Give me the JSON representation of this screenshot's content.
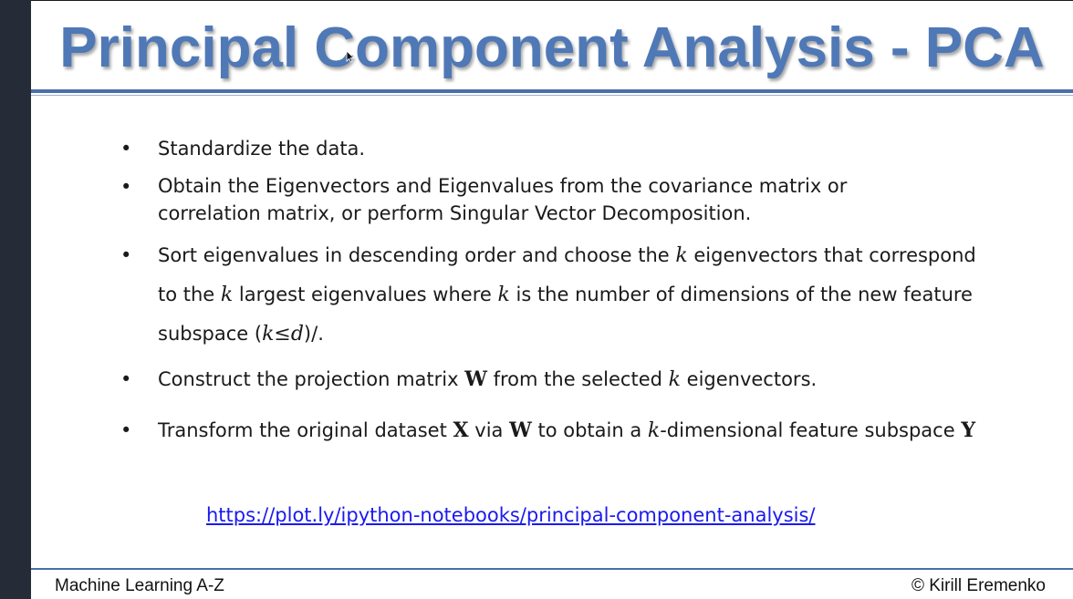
{
  "slide": {
    "title": "Principal Component Analysis - PCA",
    "bullet_glyph": "•",
    "bullets": {
      "b1": {
        "text": "Standardize the data."
      },
      "b2": {
        "line1": "Obtain the Eigenvectors and Eigenvalues from the covariance matrix or",
        "line2": "correlation matrix, or perform Singular Vector Decomposition."
      },
      "b3": {
        "t1": "Sort eigenvalues in descending order and choose the ",
        "k1": "k",
        "t2": " eigenvectors that correspond to the ",
        "k2": "k",
        "t3": " largest eigenvalues where ",
        "k3": "k",
        "t4": " is the number of dimensions of the new feature subspace (",
        "expr": "k≤d",
        "t5": ")/."
      },
      "b4": {
        "t1": "Construct the projection matrix ",
        "W": "W",
        "t2": " from the selected ",
        "k": "k",
        "t3": " eigenvectors."
      },
      "b5": {
        "t1": "Transform the original dataset ",
        "X": "X",
        "t2": " via ",
        "W": "W",
        "t3": " to obtain a ",
        "k": "k",
        "t4": "-dimensional feature subspace ",
        "Y": "Y"
      }
    },
    "link": "https://plot.ly/ipython-notebooks/principal-component-analysis/"
  },
  "footer": {
    "left": "Machine Learning A-Z",
    "right": "© Kirill Eremenko"
  },
  "colors": {
    "title": "#4f78b6",
    "rule": "#4a6fa8",
    "link": "#1a1aee",
    "sidebar": "#252c37"
  }
}
